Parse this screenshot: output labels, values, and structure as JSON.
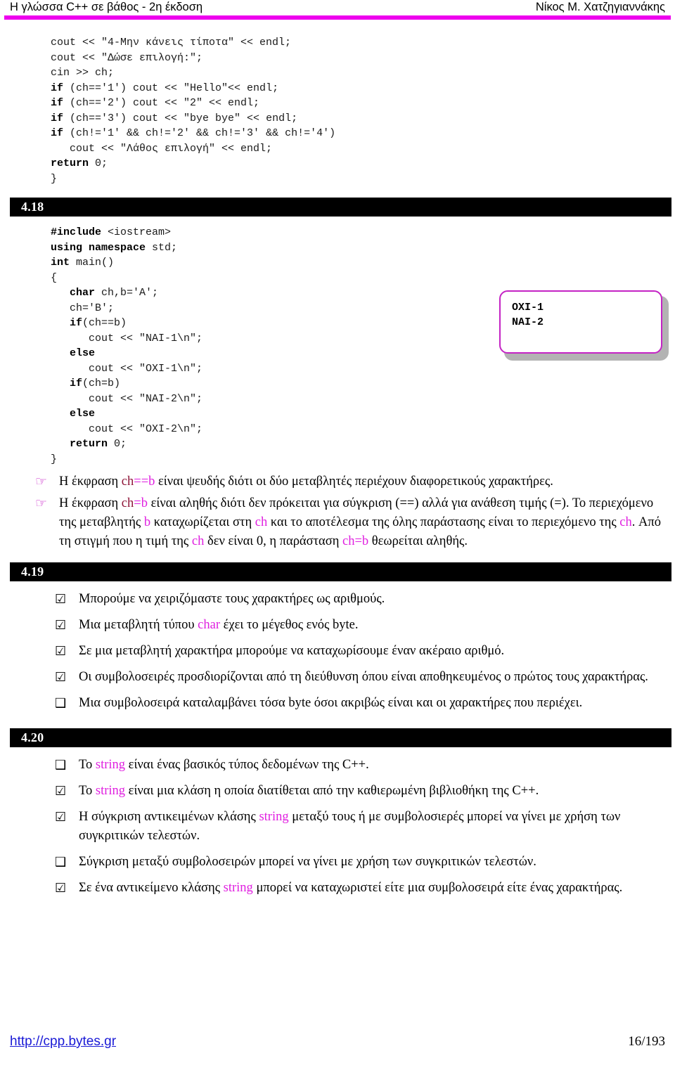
{
  "header": {
    "left_title": "Η γλώσσα C++ σε βάθος - 2η έκδοση",
    "right_author": "Νίκος Μ. Χατζηγιαννάκης",
    "rule_color": "#ee00ee"
  },
  "code_top": {
    "lines": [
      "cout << \"4-Μην κάνεις τίποτα\" << endl;",
      "cout << \"Δώσε επιλογή:\";",
      "cin >> ch;",
      "if (ch=='1') cout << \"Hello\"<< endl;",
      "if (ch=='2') cout << \"2\" << endl;",
      "if (ch=='3') cout << \"bye bye\" << endl;",
      "if (ch!='1' && ch!='2' && ch!='3' && ch!='4')",
      "   cout << \"Λάθος επιλογή\" << endl;",
      "return 0;"
    ],
    "closing_brace": "}"
  },
  "sections": [
    {
      "number": "4.18"
    },
    {
      "number": "4.19"
    },
    {
      "number": "4.20"
    }
  ],
  "code_418": {
    "lines": [
      "#include <iostream>",
      "using namespace std;",
      "int main()",
      "{",
      "   char ch,b='A';",
      "   ch='B';",
      "   if(ch==b)",
      "      cout << \"NAI-1\\n\";",
      "   else",
      "      cout << \"OXI-1\\n\";",
      "   if(ch=b)",
      "      cout << \"NAI-2\\n\";",
      "   else",
      "      cout << \"OXI-2\\n\";",
      "   return 0;",
      "}"
    ]
  },
  "output_box": {
    "border_color": "#c423c4",
    "shadow_color": "#b3b3b3",
    "lines": [
      "OXI-1",
      "NAI-2"
    ]
  },
  "notes_418": {
    "bullet_icon": "pointing-hand",
    "items": [
      {
        "parts": [
          {
            "t": "Η έκφραση ",
            "c": "black"
          },
          {
            "t": "ch",
            "c": "darkred"
          },
          {
            "t": "==",
            "c": "magenta"
          },
          {
            "t": "b",
            "c": "magenta"
          },
          {
            "t": " είναι ψευδής διότι οι δύο μεταβλητές περιέχουν διαφορετικούς  χαρακτήρες.",
            "c": "black"
          }
        ]
      },
      {
        "parts": [
          {
            "t": "Η έκφραση  ",
            "c": "black"
          },
          {
            "t": "ch",
            "c": "darkred"
          },
          {
            "t": "=",
            "c": "magenta"
          },
          {
            "t": "b",
            "c": "magenta"
          },
          {
            "t": " είναι αληθής διότι δεν πρόκειται για σύγκριση (==) αλλά για ανάθεση τιμής (=). Το περιεχόμενο της μεταβλητής ",
            "c": "black"
          },
          {
            "t": "b",
            "c": "magenta"
          },
          {
            "t": " καταχωρίζεται στη ",
            "c": "black"
          },
          {
            "t": "ch",
            "c": "magenta"
          },
          {
            "t": " και το αποτέλεσμα της όλης παράστασης είναι το περιεχόμενο της ",
            "c": "black"
          },
          {
            "t": "ch",
            "c": "magenta"
          },
          {
            "t": ". Από τη στιγμή που η τιμή της ",
            "c": "black"
          },
          {
            "t": "ch",
            "c": "magenta"
          },
          {
            "t": " δεν είναι 0, η παράσταση ",
            "c": "black"
          },
          {
            "t": "ch=b",
            "c": "magenta"
          },
          {
            "t": " θεωρείται αληθής.",
            "c": "black"
          }
        ]
      }
    ]
  },
  "notes_419": {
    "items": [
      {
        "checked": true,
        "parts": [
          {
            "t": "Μπορούμε να χειριζόμαστε τους χαρακτήρες ως αριθμούς.",
            "c": "black"
          }
        ]
      },
      {
        "checked": true,
        "parts": [
          {
            "t": "Μια μεταβλητή τύπου ",
            "c": "black"
          },
          {
            "t": "char",
            "c": "magenta"
          },
          {
            "t": " έχει το μέγεθος ενός byte.",
            "c": "black"
          }
        ]
      },
      {
        "checked": true,
        "parts": [
          {
            "t": "Σε μια μεταβλητή χαρακτήρα μπορούμε να καταχωρίσουμε έναν ακέραιο αριθμό.",
            "c": "black"
          }
        ]
      },
      {
        "checked": true,
        "parts": [
          {
            "t": "Οι συμβολοσειρές προσδιορίζονται από τη διεύθυνση όπου είναι αποθηκευμένος ο πρώτος τους χαρακτήρας.",
            "c": "black"
          }
        ]
      },
      {
        "checked": false,
        "parts": [
          {
            "t": "Μια συμβολοσειρά καταλαμβάνει τόσα byte όσοι ακριβώς είναι και οι χαρακτήρες που περιέχει.",
            "c": "black"
          }
        ]
      }
    ]
  },
  "notes_420": {
    "items": [
      {
        "checked": false,
        "parts": [
          {
            "t": "Το ",
            "c": "black"
          },
          {
            "t": "string",
            "c": "magenta"
          },
          {
            "t": " είναι ένας βασικός τύπος δεδομένων της C++.",
            "c": "black"
          }
        ]
      },
      {
        "checked": true,
        "parts": [
          {
            "t": "Το ",
            "c": "black"
          },
          {
            "t": "string",
            "c": "magenta"
          },
          {
            "t": " είναι μια κλάση η οποία διατίθεται από την καθιερωμένη βιβλιοθήκη της C++.",
            "c": "black"
          }
        ]
      },
      {
        "checked": true,
        "parts": [
          {
            "t": "Η σύγκριση αντικειμένων κλάσης ",
            "c": "black"
          },
          {
            "t": "string",
            "c": "magenta"
          },
          {
            "t": " μεταξύ τους ή με συμβολοσιερές μπορεί να γίνει με χρήση των συγκριτικών τελεστών.",
            "c": "black"
          }
        ]
      },
      {
        "checked": false,
        "parts": [
          {
            "t": "Σύγκριση μεταξύ συμβολοσειρών μπορεί να γίνει με χρήση των συγκριτικών τελεστών.",
            "c": "black"
          }
        ]
      },
      {
        "checked": true,
        "parts": [
          {
            "t": "Σε ένα αντικείμενο κλάσης ",
            "c": "black"
          },
          {
            "t": "string",
            "c": "magenta"
          },
          {
            "t": " μπορεί να καταχωριστεί είτε μια συμβολοσειρά είτε ένας χαρακτήρας.",
            "c": "black"
          }
        ]
      }
    ]
  },
  "footer": {
    "url": "http://cpp.bytes.gr",
    "page": "16/193",
    "url_color": "#1a1ad6"
  },
  "icons": {
    "checked": "☑",
    "unchecked": "❑",
    "hand": "☞"
  }
}
